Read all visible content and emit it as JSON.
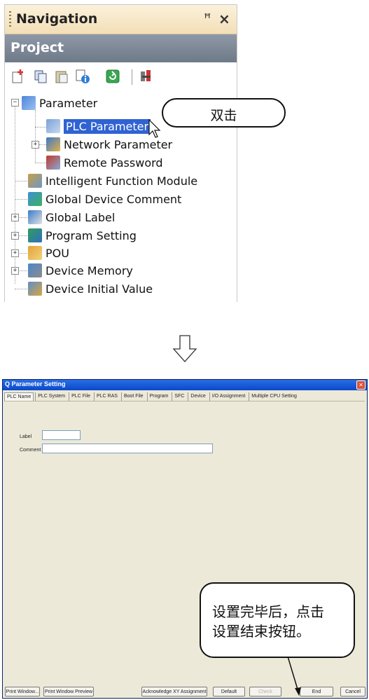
{
  "navigation": {
    "title": "Navigation",
    "pin_icon": "pin-icon",
    "close_icon": "close-icon",
    "project_label": "Project",
    "toolbar_icons": [
      "new-data-icon",
      "copy-icon",
      "paste-icon",
      "property-icon",
      "refresh-icon",
      "find-icon"
    ],
    "tree": [
      {
        "label": "Parameter",
        "icon": "parameter-folder-icon",
        "expander": "−"
      },
      {
        "label": "PLC Parameter",
        "icon": "plc-parameter-icon",
        "selected": true
      },
      {
        "label": "Network Parameter",
        "icon": "network-parameter-icon",
        "expander": "+"
      },
      {
        "label": "Remote Password",
        "icon": "remote-password-icon"
      },
      {
        "label": "Intelligent Function Module",
        "icon": "intelligent-module-icon"
      },
      {
        "label": "Global Device Comment",
        "icon": "device-comment-icon"
      },
      {
        "label": "Global Label",
        "icon": "global-label-icon",
        "expander": "+"
      },
      {
        "label": "Program Setting",
        "icon": "program-setting-icon",
        "expander": "+"
      },
      {
        "label": "POU",
        "icon": "pou-icon",
        "expander": "+"
      },
      {
        "label": "Device Memory",
        "icon": "device-memory-icon",
        "expander": "+"
      },
      {
        "label": "Device Initial Value",
        "icon": "device-initial-value-icon"
      }
    ]
  },
  "callout_top": "双击",
  "arrow_icon": "down-arrow-icon",
  "dialog": {
    "title": "Q Parameter Setting",
    "close_icon": "close-icon",
    "tabs": [
      "PLC Name",
      "PLC System",
      "PLC File",
      "PLC RAS",
      "Boot File",
      "Program",
      "SFC",
      "Device",
      "I/O Assignment",
      "Multiple CPU Setting"
    ],
    "active_tab": 0,
    "label_caption": "Label",
    "label_value": "",
    "comment_caption": "Comment",
    "comment_value": "",
    "buttons": {
      "print_window": "Print Window...",
      "print_window_preview": "Print Window Preview",
      "acknowledge_xy": "Acknowledge XY Assignment",
      "default": "Default",
      "check": "Check",
      "end": "End",
      "cancel": "Cancel"
    }
  },
  "callout_bottom": {
    "line1": "设置完毕后，点击",
    "line2": "设置结束按钮。"
  },
  "colors": {
    "nav_title_bg": "#f3dfb7",
    "project_header_bg": "#7c8796",
    "selection": "#2f62d3",
    "dialog_bg": "#ece9d8",
    "dialog_titlebar": "#0a48c9"
  }
}
